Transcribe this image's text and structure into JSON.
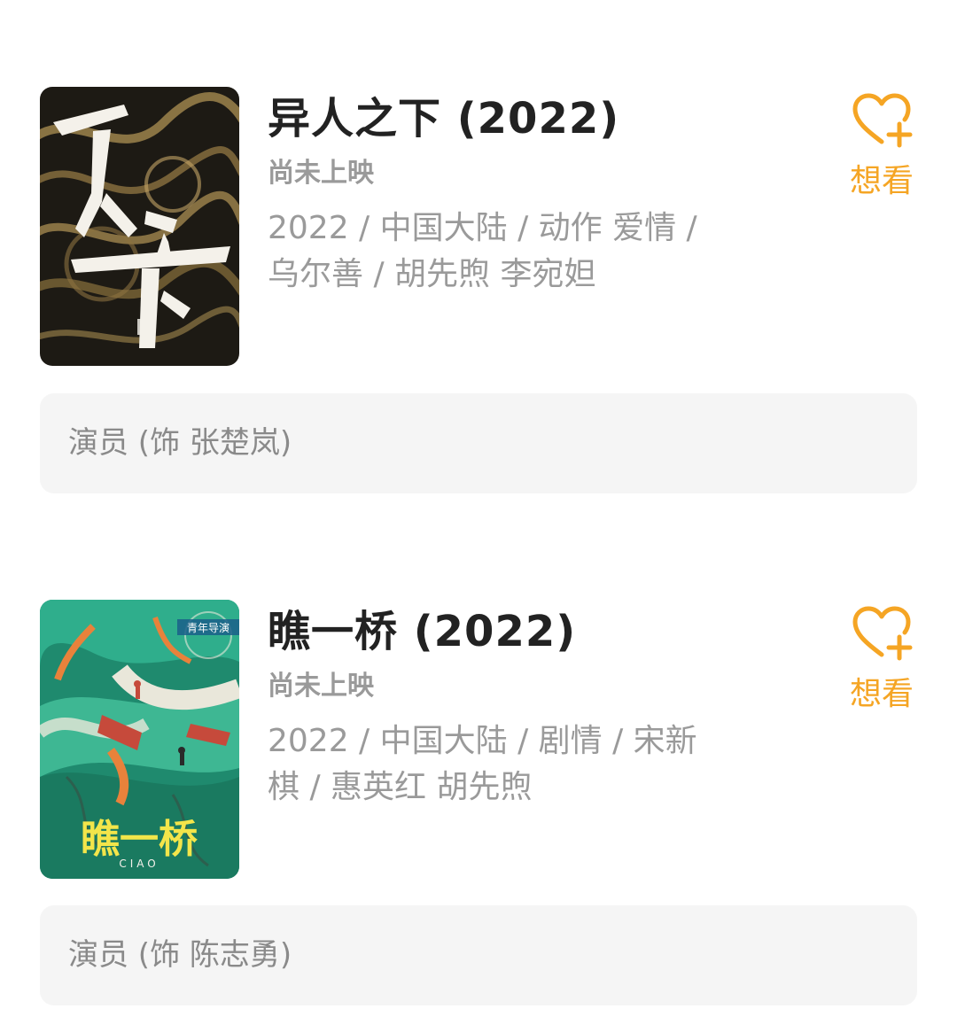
{
  "movies": [
    {
      "title": "异人之下 (2022)",
      "status": "尚未上映",
      "meta_line1": "2022 / 中国大陆 / 动作 爱情 /",
      "meta_line2": "乌尔善 / 胡先煦 李宛妲",
      "wish_label": "想看",
      "role": "演员 (饰 张楚岚)",
      "poster_text": "一人之下",
      "poster_colors": {
        "bg": "#1d1a14",
        "swirl": "#a58a4f",
        "text": "#f4f1ea"
      }
    },
    {
      "title": "瞧一桥 (2022)",
      "status": "尚未上映",
      "meta_line1": "2022 / 中国大陆 / 剧情 / 宋新",
      "meta_line2": "棋 / 惠英红 胡先煦",
      "wish_label": "想看",
      "role": "演员 (饰 陈志勇)",
      "poster_text": "瞧一桥",
      "poster_subtext": "CIAO",
      "poster_badge": "青年导演",
      "poster_colors": {
        "bg": "#1f8a6e",
        "water": "#2fae8c",
        "text": "#f3e54a"
      }
    }
  ],
  "colors": {
    "accent": "#f5a524",
    "title": "#222222",
    "secondary": "#9a9a9a",
    "role_bg": "#f5f5f5"
  },
  "icons": {
    "wish": "heart-plus-icon"
  }
}
